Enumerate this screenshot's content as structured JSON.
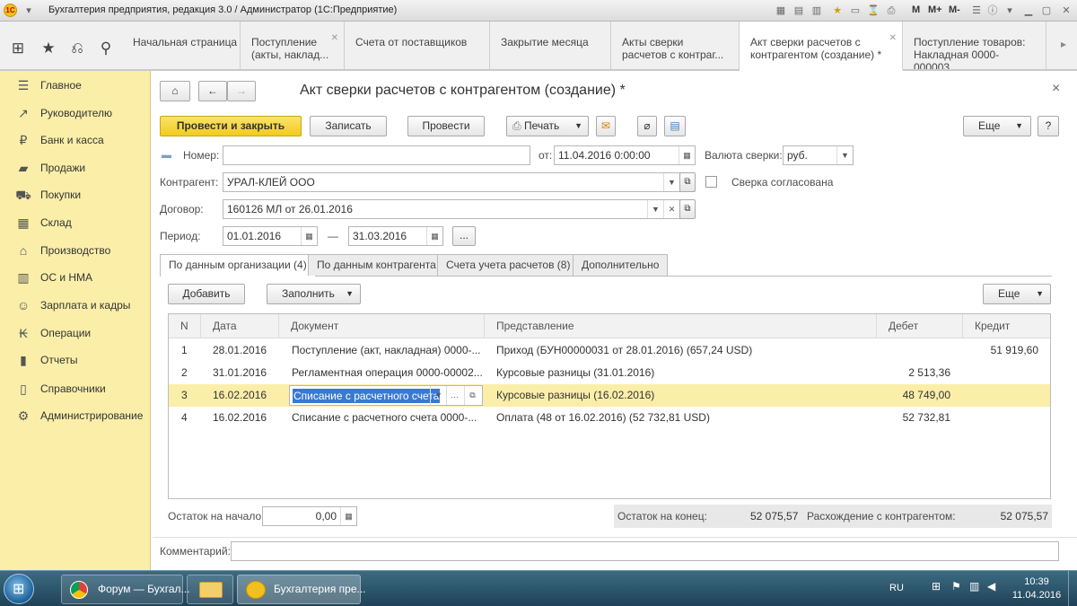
{
  "window": {
    "title": "Бухгалтерия предприятия, редакция 3.0 / Администратор  (1С:Предприятие)",
    "logo_text": "1С",
    "memory_buttons": [
      "M",
      "M+",
      "M-"
    ]
  },
  "open_tabs": [
    {
      "label": "Начальная страница",
      "closable": false
    },
    {
      "label": "Поступление (акты, наклад...",
      "closable": true
    },
    {
      "label": "Счета от поставщиков",
      "closable": false
    },
    {
      "label": "Закрытие месяца",
      "closable": false
    },
    {
      "label": "Акты сверки расчетов с контраг...",
      "closable": false
    },
    {
      "label": "Акт сверки расчетов с контрагентом (создание) *",
      "closable": true
    },
    {
      "label": "Поступление товаров: Накладная 0000-000003...",
      "closable": false
    }
  ],
  "sidebar": {
    "items": [
      {
        "label": "Главное",
        "icon": "menu-icon"
      },
      {
        "label": "Руководителю",
        "icon": "chart-icon"
      },
      {
        "label": "Банк и касса",
        "icon": "coin-icon"
      },
      {
        "label": "Продажи",
        "icon": "bag-icon"
      },
      {
        "label": "Покупки",
        "icon": "cart-icon"
      },
      {
        "label": "Склад",
        "icon": "warehouse-icon"
      },
      {
        "label": "Производство",
        "icon": "factory-icon"
      },
      {
        "label": "ОС и НМА",
        "icon": "assets-icon"
      },
      {
        "label": "Зарплата и кадры",
        "icon": "people-icon"
      },
      {
        "label": "Операции",
        "icon": "operations-icon"
      },
      {
        "label": "Отчеты",
        "icon": "reports-icon"
      },
      {
        "label": "Справочники",
        "icon": "book-icon"
      },
      {
        "label": "Администрирование",
        "icon": "gear-icon"
      }
    ]
  },
  "form": {
    "title": "Акт сверки расчетов с контрагентом (создание) *",
    "toolbar": {
      "post_close": "Провести и закрыть",
      "save": "Записать",
      "post": "Провести",
      "print": "Печать",
      "more": "Еще",
      "help": "?"
    },
    "number_label": "Номер:",
    "number_value": "",
    "date_label": "от:",
    "date_value": "11.04.2016  0:00:00",
    "currency_label": "Валюта сверки:",
    "currency_value": "руб.",
    "counterparty_label": "Контрагент:",
    "counterparty_value": "УРАЛ-КЛЕЙ ООО",
    "agreed_label": "Сверка согласована",
    "agreed_checked": false,
    "contract_label": "Договор:",
    "contract_value": "160126 МЛ от 26.01.2016",
    "period_label": "Период:",
    "period_from": "01.01.2016",
    "period_dash": "—",
    "period_to": "31.03.2016",
    "period_more": "...",
    "tabs": [
      {
        "label": "По данным организации (4)",
        "active": true
      },
      {
        "label": "По данным контрагента",
        "active": false
      },
      {
        "label": "Счета учета расчетов (8)",
        "active": false
      },
      {
        "label": "Дополнительно",
        "active": false
      }
    ],
    "table_toolbar": {
      "add": "Добавить",
      "fill": "Заполнить",
      "more": "Еще"
    },
    "columns": [
      "N",
      "Дата",
      "Документ",
      "Представление",
      "Дебет",
      "Кредит"
    ],
    "rows": [
      {
        "n": "1",
        "date": "28.01.2016",
        "doc": "Поступление (акт, накладная) 0000-...",
        "repr": "Приход (БУН00000031 от 28.01.2016) (657,24 USD)",
        "debit": "",
        "credit": "51 919,60",
        "selected": false
      },
      {
        "n": "2",
        "date": "31.01.2016",
        "doc": "Регламентная операция 0000-00002...",
        "repr": "Курсовые разницы (31.01.2016)",
        "debit": "2 513,36",
        "credit": "",
        "selected": false
      },
      {
        "n": "3",
        "date": "16.02.2016",
        "doc": "Списание с расчетного счета",
        "repr": "Курсовые разницы (16.02.2016)",
        "debit": "48 749,00",
        "credit": "",
        "selected": true
      },
      {
        "n": "4",
        "date": "16.02.2016",
        "doc": "Списание с расчетного счета 0000-...",
        "repr": "Оплата (48 от 16.02.2016) (52 732,81 USD)",
        "debit": "52 732,81",
        "credit": "",
        "selected": false
      }
    ],
    "opening_label": "Остаток на начало:",
    "opening_value": "0,00",
    "closing_label": "Остаток на конец:",
    "closing_value": "52 075,57",
    "diff_label": "Расхождение с контрагентом:",
    "diff_value": "52 075,57",
    "comment_label": "Комментарий:",
    "comment_value": ""
  },
  "taskbar": {
    "items": [
      {
        "label": "Форум — Бухгал..."
      },
      {
        "label": ""
      },
      {
        "label": "Бухгалтерия пре..."
      }
    ],
    "lang": "RU",
    "time": "10:39",
    "date": "11.04.2016"
  }
}
